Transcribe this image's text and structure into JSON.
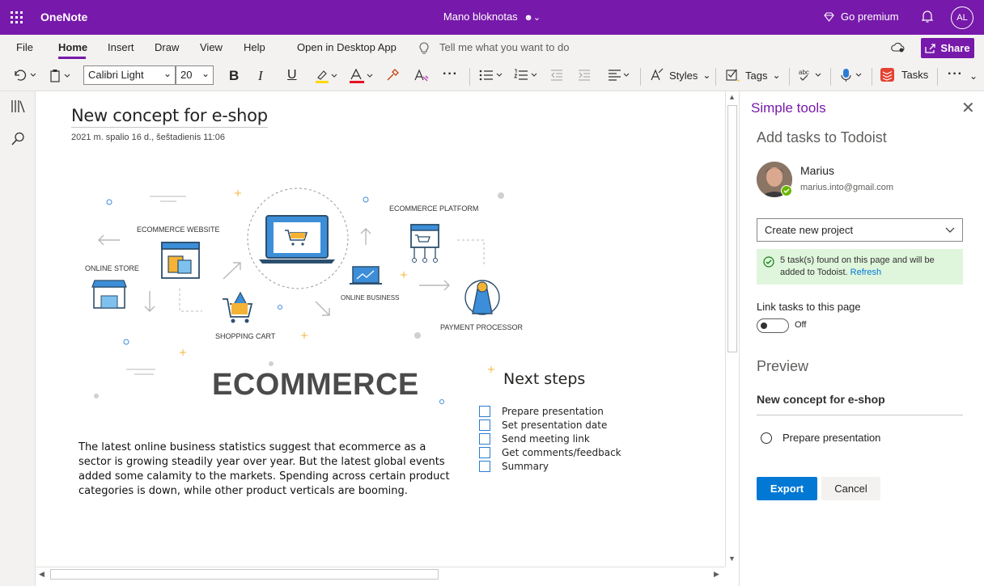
{
  "titlebar": {
    "app_name": "OneNote",
    "notebook": "Mano bloknotas",
    "premium": "Go premium",
    "user_initials": "AL"
  },
  "menu": {
    "file": "File",
    "home": "Home",
    "insert": "Insert",
    "draw": "Draw",
    "view": "View",
    "help": "Help",
    "open_desktop": "Open in Desktop App",
    "tell_me": "Tell me what you want to do",
    "share": "Share"
  },
  "toolbar": {
    "font_name": "Calibri Light",
    "font_size": "20",
    "bold": "B",
    "italic": "I",
    "underline": "U",
    "styles": "Styles",
    "tags": "Tags",
    "tasks": "Tasks",
    "more": "···"
  },
  "page": {
    "title": "New concept for e-shop",
    "date": "2021 m. spalio 16 d., šeštadienis     11:06",
    "illustration": {
      "ecommerce_website": "ECOMMERCE WEBSITE",
      "online_store": "ONLINE STORE",
      "shopping_cart": "SHOPPING CART",
      "ecommerce_platform": "ECOMMERCE PLATFORM",
      "online_business": "ONLINE BUSINESS",
      "payment_processor": "PAYMENT PROCESSOR",
      "headline": "ECOMMERCE"
    },
    "body": "The latest online business statistics suggest that ecommerce as a sector is growing steadily year over year. But the latest global events added some calamity to the markets. Spending across certain product categories is down, while other product verticals are booming.",
    "next_steps_title": "Next steps",
    "tasks": [
      "Prepare presentation",
      "Set presentation date",
      "Send meeting link",
      "Get comments/feedback",
      "Summary"
    ]
  },
  "panel": {
    "title": "Simple tools",
    "subtitle": "Add tasks to Todoist",
    "user_name": "Marius",
    "user_email": "marius.into@gmail.com",
    "project_select": "Create new project",
    "message": "5 task(s) found on this page and will be added to Todoist.",
    "refresh": "Refresh",
    "link_label": "Link tasks to this page",
    "toggle_state": "Off",
    "preview_heading": "Preview",
    "preview_title": "New concept for e-shop",
    "preview_item": "Prepare presentation",
    "export": "Export",
    "cancel": "Cancel"
  },
  "colors": {
    "brand": "#7719aa",
    "primary_button": "#0078d4",
    "success_bg": "#dff6dd",
    "checkbox": "#2b7cd3"
  }
}
